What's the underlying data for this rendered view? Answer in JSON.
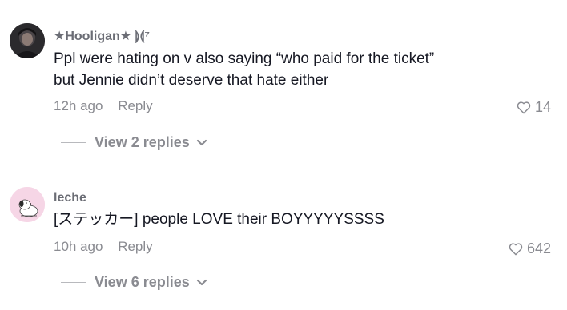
{
  "comments": [
    {
      "username": "★Hooligan★ ⟭⟬⁷",
      "text_line1": "Ppl were hating on v also saying “who paid for the ticket”",
      "text_line2": "but Jennie didn’t deserve that hate either",
      "time": "12h ago",
      "reply_label": "Reply",
      "likes": "14",
      "view_replies": "View 2 replies",
      "avatar_icon": "dark-portrait-avatar"
    },
    {
      "username": "leche",
      "text_line1": "[ステッカー] people LOVE their BOYYYYYSSSS",
      "time": "10h ago",
      "reply_label": "Reply",
      "likes": "642",
      "view_replies": "View 6 replies",
      "avatar_icon": "snoopy-avatar"
    }
  ],
  "colors": {
    "primary_text": "#161823",
    "secondary_text": "#8a8b91",
    "username": "#6b6d75",
    "avatar2_bg": "#f6d6e6"
  }
}
